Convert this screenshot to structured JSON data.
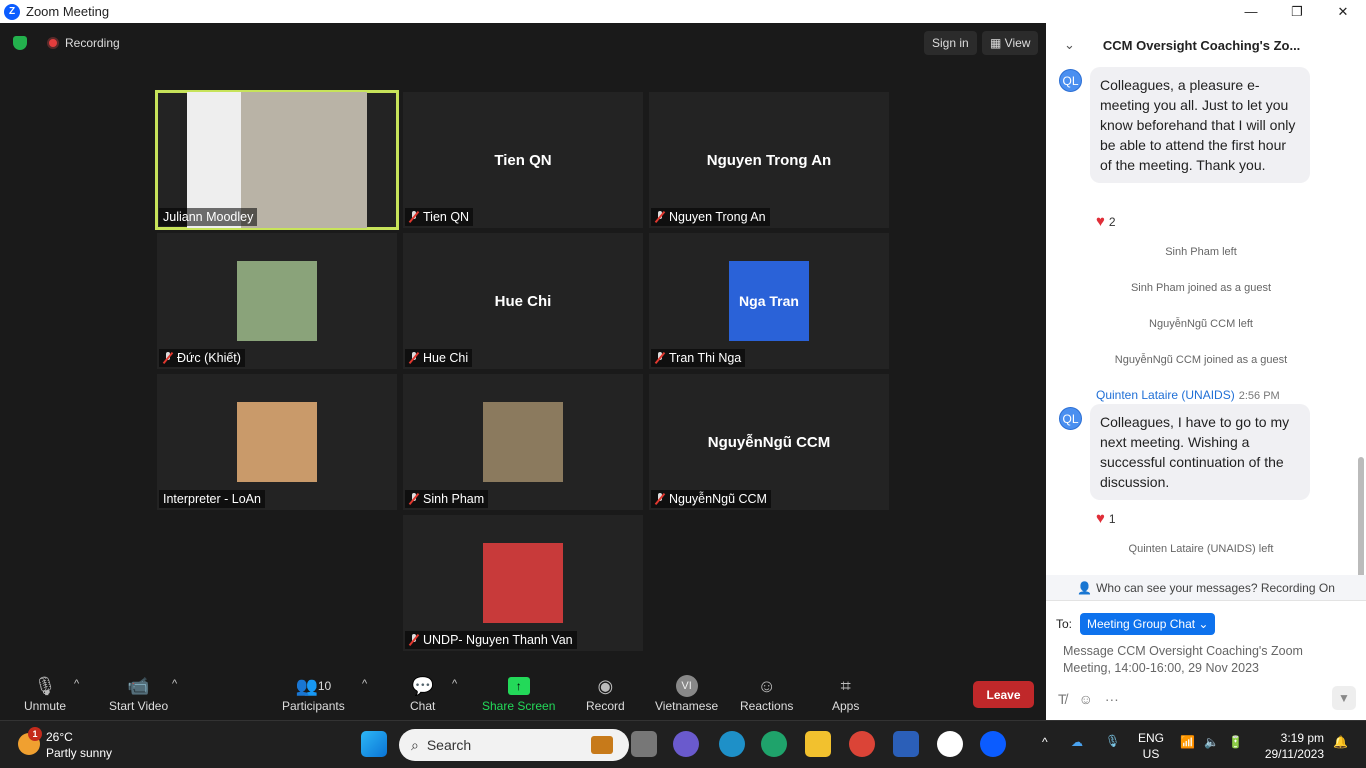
{
  "window": {
    "title": "Zoom Meeting",
    "minimize": "—",
    "maximize": "❐",
    "close": "✕"
  },
  "topbar": {
    "recording": "Recording",
    "sign_in": "Sign in",
    "view": "View"
  },
  "tiles": [
    {
      "name": "Juliann Moodley",
      "display": "",
      "muted": false,
      "video": true,
      "active": true,
      "photo_color": "#b9b3a6"
    },
    {
      "name": "Tien QN",
      "display": "Tien QN",
      "muted": true
    },
    {
      "name": "Nguyen Trong An",
      "display": "Nguyen Trong An",
      "muted": true
    },
    {
      "name": "Đức (Khiết)",
      "display": "",
      "muted": true,
      "photo_color": "#8aa37a"
    },
    {
      "name": "Hue Chi",
      "display": "Hue Chi",
      "muted": true
    },
    {
      "name": "Tran Thi Nga",
      "display": "Nga Tran",
      "muted": true,
      "avatar_color": "#2a62d8"
    },
    {
      "name": "Interpreter - LoAn",
      "display": "",
      "muted": false,
      "photo_color": "#c99a6a"
    },
    {
      "name": "Sinh Pham",
      "display": "",
      "muted": true,
      "photo_color": "#8b7a5e"
    },
    {
      "name": "NguyễnNgũ CCM",
      "display": "NguyễnNgũ CCM",
      "muted": true
    },
    {
      "name": "UNDP- Nguyen Thanh Van",
      "display": "",
      "muted": true,
      "photo_color": "#c83a3a"
    }
  ],
  "toolbar": {
    "unmute": "Unmute",
    "start_video": "Start Video",
    "participants": "Participants",
    "participants_count": "10",
    "chat": "Chat",
    "share_screen": "Share Screen",
    "record": "Record",
    "language": "Vietnamese",
    "language_badge": "VI",
    "reactions": "Reactions",
    "apps": "Apps",
    "leave": "Leave"
  },
  "chat": {
    "title": "CCM Oversight Coaching's Zo...",
    "messages": [
      {
        "avatar": "QL",
        "text": "Colleagues, a pleasure e-meeting you all. Just to let you know beforehand that I will only be able to attend the first hour of the meeting. Thank you.",
        "reaction_count": "2"
      },
      {
        "sender": "Quinten Lataire (UNAIDS)",
        "time": "2:56 PM",
        "avatar": "QL",
        "text": "Colleagues, I have to go to my next meeting. Wishing a successful continuation of the discussion.",
        "reaction_count": "1"
      }
    ],
    "system": [
      "Sinh Pham left",
      "Sinh Pham joined as a guest",
      "NguyễnNgũ CCM left",
      "NguyễnNgũ CCM joined as a guest",
      "Quinten Lataire (UNAIDS) left"
    ],
    "visibility": "Who can see your messages? Recording On",
    "to_label": "To:",
    "recipient": "Meeting Group Chat",
    "placeholder": "Message CCM Oversight Coaching's Zoom Meeting, 14:00-16:00, 29 Nov 2023"
  },
  "taskbar": {
    "temp": "26°C",
    "weather": "Partly sunny",
    "weather_badge": "1",
    "search": "Search",
    "lang1": "ENG",
    "lang2": "US",
    "time": "3:19 pm",
    "date": "29/11/2023"
  },
  "colors": {
    "accent": "#0e72ed",
    "leave": "#c0282a",
    "share": "#23d959",
    "active_speaker": "#c7e35a"
  }
}
